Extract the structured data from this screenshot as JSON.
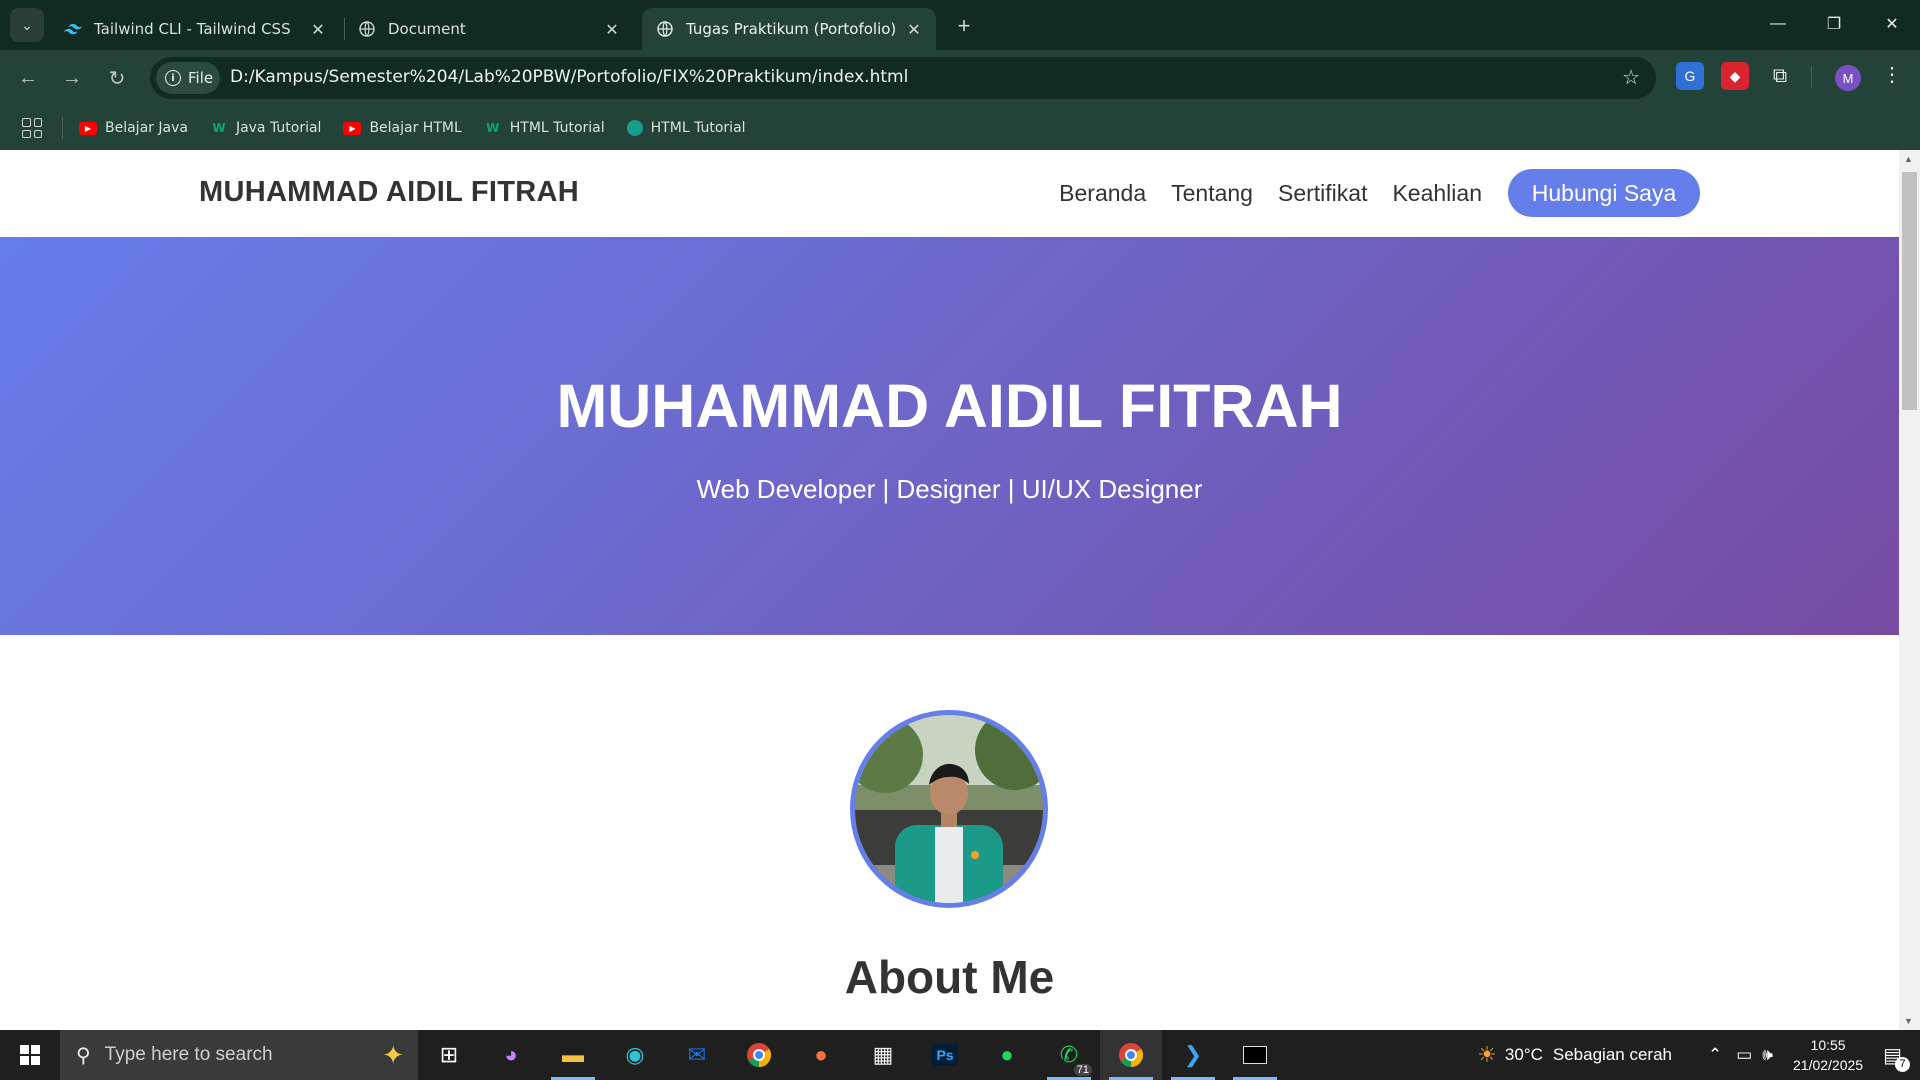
{
  "browser": {
    "tabs": [
      {
        "title": "Tailwind CLI - Tailwind CSS",
        "icon": "tailwind-icon"
      },
      {
        "title": "Document",
        "icon": "globe-icon"
      },
      {
        "title": "Tugas Praktikum (Portofolio)",
        "icon": "globe-icon",
        "active": true
      }
    ],
    "address": {
      "scheme_label": "File",
      "url": "D:/Kampus/Semester%204/Lab%20PBW/Portofolio/FIX%20Praktikum/index.html"
    },
    "profile_initial": "M",
    "bookmarks": [
      {
        "label": "Belajar Java",
        "icon": "youtube-icon"
      },
      {
        "label": "Java Tutorial",
        "icon": "w3schools-icon"
      },
      {
        "label": "Belajar HTML",
        "icon": "youtube-icon"
      },
      {
        "label": "HTML Tutorial",
        "icon": "w3schools-icon"
      },
      {
        "label": "HTML Tutorial",
        "icon": "site-icon"
      }
    ]
  },
  "site": {
    "brand": "MUHAMMAD AIDIL FITRAH",
    "nav": [
      "Beranda",
      "Tentang",
      "Sertifikat",
      "Keahlian"
    ],
    "cta": "Hubungi Saya",
    "hero_title": "MUHAMMAD AIDIL FITRAH",
    "hero_subtitle": "Web Developer | Designer | UI/UX Designer",
    "about_heading": "About Me"
  },
  "taskbar": {
    "search_placeholder": "Type here to search",
    "whatsapp_badge": "71",
    "weather_temp": "30°C",
    "weather_text": "Sebagian cerah",
    "time": "10:55",
    "date": "21/02/2025",
    "notification_count": "7"
  },
  "colors": {
    "accent": "#667eea",
    "hero_gradient_end": "#764ba2",
    "chrome_frame": "#112a22",
    "chrome_toolbar": "#234238"
  }
}
